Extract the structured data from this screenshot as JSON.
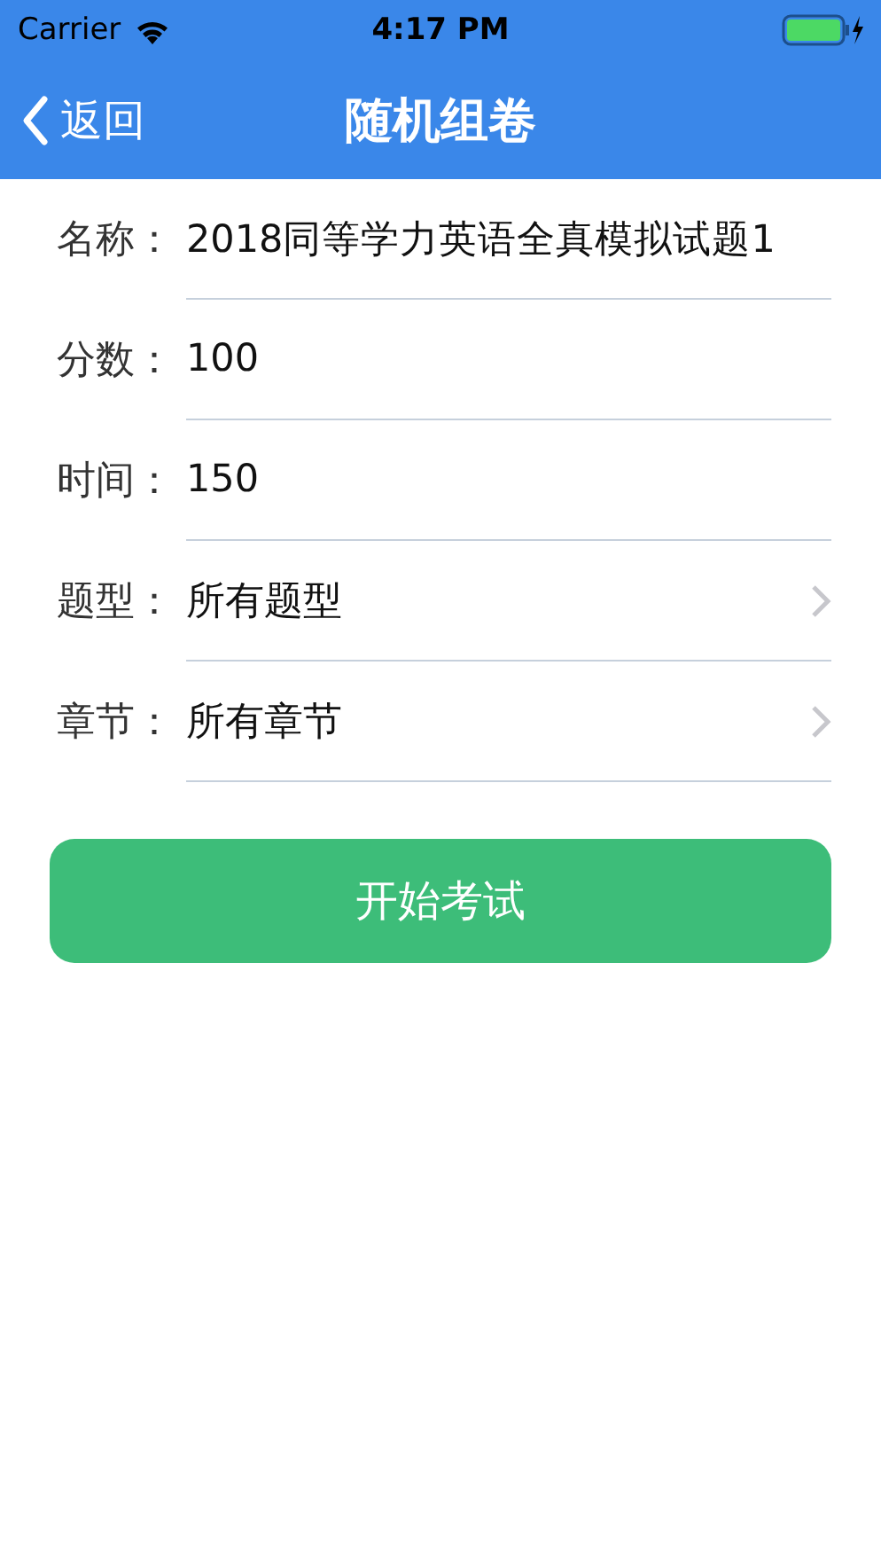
{
  "status_bar": {
    "carrier": "Carrier",
    "time": "4:17 PM"
  },
  "nav": {
    "back": "返回",
    "title": "随机组卷"
  },
  "fields": [
    {
      "kind": "input",
      "label": "名称：",
      "value": "2018同等学力英语全真模拟试题1"
    },
    {
      "kind": "input",
      "label": "分数：",
      "value": "100"
    },
    {
      "kind": "input",
      "label": "时间：",
      "value": "150"
    },
    {
      "kind": "select",
      "label": "题型：",
      "value": "所有题型"
    },
    {
      "kind": "select",
      "label": "章节：",
      "value": "所有章节"
    }
  ],
  "submit": "开始考试"
}
